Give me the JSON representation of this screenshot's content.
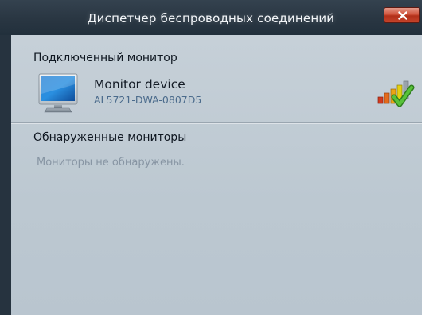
{
  "window": {
    "title": "Диспетчер беспроводных соединений"
  },
  "connected": {
    "section_title": "Подключенный монитор",
    "device_name": "Monitor device",
    "device_id": "AL5721-DWA-0807D5",
    "icon": "monitor-icon",
    "status_icon": "signal-strength-connected-icon"
  },
  "discovered": {
    "section_title": "Обнаруженные мониторы",
    "empty_message": "Мониторы не обнаружены."
  },
  "colors": {
    "titlebar": "#2a3743",
    "content_bg": "#c0cbd4",
    "close_button": "#c4432a",
    "device_id": "#4b6b8c",
    "muted_text": "#8795a3",
    "check": "#3fa52a"
  }
}
